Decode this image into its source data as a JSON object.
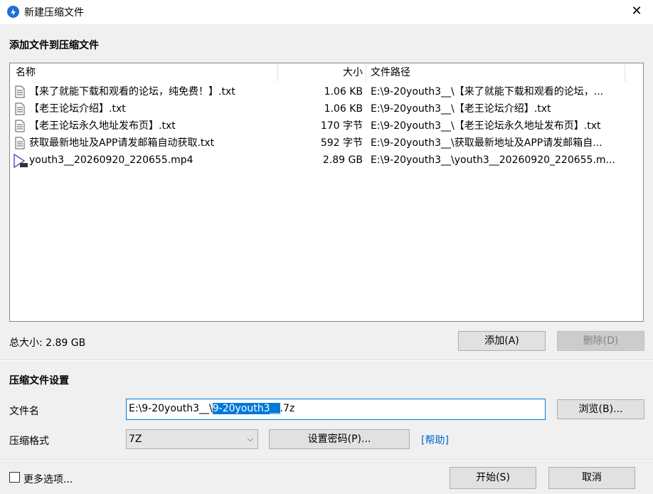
{
  "window": {
    "title": "新建压缩文件",
    "close_glyph": "✕"
  },
  "files_section": {
    "title": "添加文件到压缩文件",
    "columns": {
      "name": "名称",
      "size": "大小",
      "path": "文件路径"
    },
    "rows": [
      {
        "name": "【来了就能下载和观看的论坛，纯免费！】.txt",
        "size": "1.06 KB",
        "path": "E:\\9-20youth3__\\【来了就能下载和观看的论坛，...",
        "icon": "text-file-icon"
      },
      {
        "name": "【老王论坛介绍】.txt",
        "size": "1.06 KB",
        "path": "E:\\9-20youth3__\\【老王论坛介绍】.txt",
        "icon": "text-file-icon"
      },
      {
        "name": "【老王论坛永久地址发布页】.txt",
        "size": "170 字节",
        "path": "E:\\9-20youth3__\\【老王论坛永久地址发布页】.txt",
        "icon": "text-file-icon"
      },
      {
        "name": "获取最新地址及APP请发邮箱自动获取.txt",
        "size": "592 字节",
        "path": "E:\\9-20youth3__\\获取最新地址及APP请发邮箱自...",
        "icon": "text-file-icon"
      },
      {
        "name": "youth3__20260920_220655.mp4",
        "size": "2.89 GB",
        "path": "E:\\9-20youth3__\\youth3__20260920_220655.m...",
        "icon": "video-file-icon"
      }
    ],
    "total_label": "总大小: 2.89 GB",
    "add_button": "添加(A)",
    "delete_button": "删除(D)"
  },
  "settings": {
    "title": "压缩文件设置",
    "filename_label": "文件名",
    "filename_prefix": "E:\\9-20youth3__\\",
    "filename_selected": "9-20youth3__",
    "filename_suffix": ".7z",
    "browse_button": "浏览(B)...",
    "format_label": "压缩格式",
    "format_value": "7Z",
    "password_button": "设置密码(P)...",
    "help_link": "[帮助]"
  },
  "footer": {
    "more_options": "更多选项...",
    "start_button": "开始(S)",
    "cancel_button": "取消"
  },
  "colors": {
    "accent": "#0078d7",
    "link": "#0066cc"
  }
}
